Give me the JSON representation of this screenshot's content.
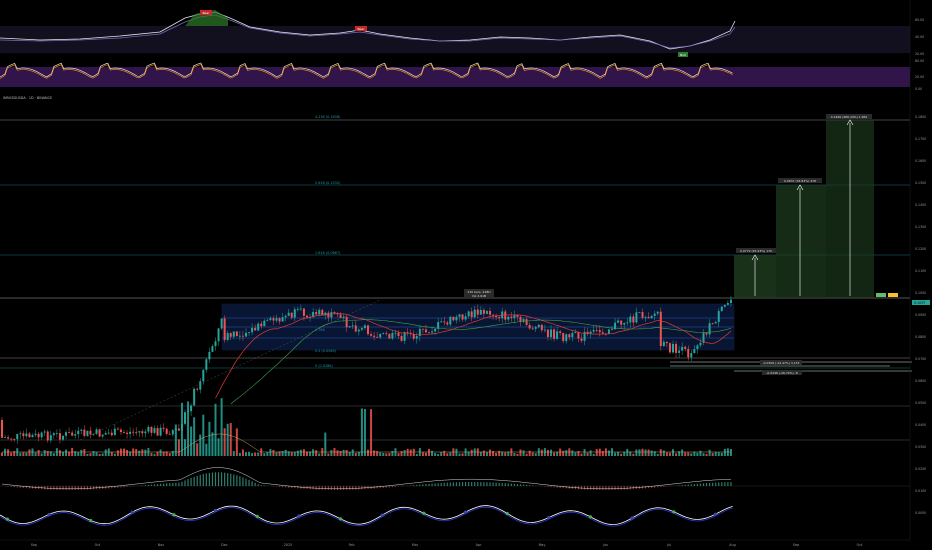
{
  "symbol": {
    "title": "INRUSDUSDA · 1D · BINANCE"
  },
  "top_scale": [
    "60.00",
    "40.00",
    "20.00"
  ],
  "stoch_scale": [
    "80.00",
    "20.00",
    "0.00"
  ],
  "price_axis": [
    "0.1800",
    "0.1700",
    "0.1600",
    "0.1500",
    "0.1400",
    "0.1300",
    "0.1200",
    "0.1100",
    "0.1000",
    "0.0900",
    "0.0800",
    "0.0700",
    "0.0600",
    "0.0500",
    "0.0400",
    "0.0300",
    "0.0200",
    "0.0100",
    "0.0000"
  ],
  "price_tag": "0.1037",
  "fib_labels": {
    "f4236": "4.236 (0.1838)",
    "f2618": "2.618 (0.1532)",
    "f1618": "1.618 (0.0867)",
    "f1": "1 (0.0707)",
    "f0786": "0.786",
    "f05": "0.5 (0.0560)",
    "f0": "0 (0.0286)"
  },
  "range_box_label": [
    "230 bars, 228D",
    "Vol 4.61B"
  ],
  "target_labels": [
    "0.1466 (486.44%) 1,962",
    "0.0837 (34.83%) 478",
    "0.0772 (45.93%) 170"
  ],
  "support_labels": [
    "-0.0308 (-24.47%) 3,153",
    "-0.0346 (-26.74%) -8"
  ],
  "indicator_badges": [
    "Bear",
    "Bear",
    "Bull"
  ],
  "months": [
    "Sep",
    "Oct",
    "Nov",
    "Dec",
    "2025",
    "Feb",
    "Mar",
    "Apr",
    "May",
    "Jun",
    "Jul",
    "Aug",
    "Sep",
    "Oct"
  ],
  "colors": {
    "up": "#26a69a",
    "down": "#ef5350",
    "fib": "#1d6f7a",
    "box": "#1e4bb8",
    "target": "#1f3d1f",
    "purple": "#3d1a5c"
  }
}
